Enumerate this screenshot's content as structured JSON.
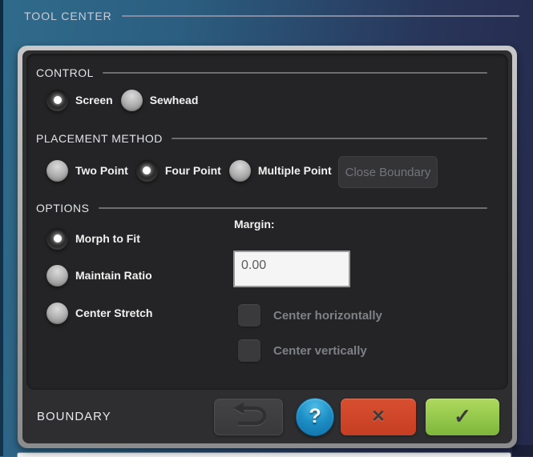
{
  "window": {
    "title": "TOOL CENTER"
  },
  "control": {
    "heading": "CONTROL",
    "options": [
      {
        "label": "Screen",
        "selected": true
      },
      {
        "label": "Sewhead",
        "selected": false
      }
    ]
  },
  "placement": {
    "heading": "PLACEMENT METHOD",
    "options": [
      {
        "label": "Two Point",
        "selected": false
      },
      {
        "label": "Four Point",
        "selected": true
      },
      {
        "label": "Multiple Point",
        "selected": false
      }
    ],
    "close_boundary": {
      "label": "Close Boundary",
      "enabled": false
    }
  },
  "options": {
    "heading": "OPTIONS",
    "radios": [
      {
        "label": "Morph to Fit",
        "selected": true
      },
      {
        "label": "Maintain Ratio",
        "selected": false
      },
      {
        "label": "Center Stretch",
        "selected": false
      }
    ],
    "margin": {
      "label": "Margin:",
      "value": "0.00"
    },
    "checkboxes": [
      {
        "label": "Center horizontally",
        "checked": false
      },
      {
        "label": "Center vertically",
        "checked": false
      }
    ]
  },
  "footer": {
    "label": "BOUNDARY",
    "help_glyph": "?",
    "cancel_glyph": "✕",
    "confirm_glyph": "✓"
  },
  "colors": {
    "help_blue": "#1d8fc6",
    "cancel_red": "#cf4127",
    "confirm_green": "#8fc843",
    "panel_bg": "#2e2e30",
    "inset_bg": "#242426",
    "background_teal": "#306b8b",
    "background_navy": "#252a4b"
  }
}
